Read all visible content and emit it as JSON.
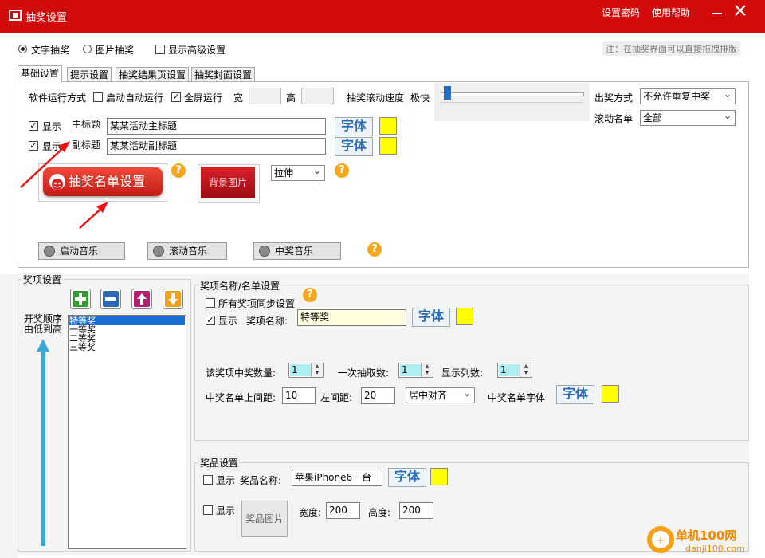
{
  "window": {
    "title": "抽奖设置",
    "links": [
      "设置密码",
      "使用帮助"
    ]
  },
  "mode": {
    "text_lottery": "文字抽奖",
    "image_lottery": "图片抽奖",
    "show_advanced": "显示高级设置"
  },
  "hint": "注：在抽奖界面可以直接拖拽排版",
  "tabs": [
    "基础设置",
    "提示设置",
    "抽奖结果页设置",
    "抽奖封面设置"
  ],
  "basic": {
    "run_mode_label": "软件运行方式",
    "auto_start": "启动自动运行",
    "fullscreen": "全屏运行",
    "width_label": "宽",
    "height_label": "高",
    "speed_label": "抽奖滚动速度",
    "speed_fast": "极快",
    "speed_value": 0.02,
    "draw_mode_label": "出奖方式",
    "draw_mode_value": "不允许重复中奖",
    "scroll_list_label": "滚动名单",
    "scroll_list_value": "全部",
    "show": "显示",
    "main_title_label": "主标题",
    "main_title_value": "某某活动主标题",
    "sub_title_label": "副标题",
    "sub_title_value": "某某活动副标题",
    "font_btn": "字体",
    "name_list_btn": "抽奖名单设置",
    "bg_image_btn": "背景图片",
    "stretch_value": "拉伸",
    "music": [
      "启动音乐",
      "滚动音乐",
      "中奖音乐"
    ],
    "colors": {
      "swatch": "#ffff00",
      "titlebar": "#d10b0b",
      "name_list_btn": "#d72c22"
    }
  },
  "prizes": {
    "group_title": "奖项设置",
    "order_label": "开奖顺序\n由低到高",
    "order_line1": "开奖顺序",
    "order_line2": "由低到高",
    "toolbar_icons": [
      "add-icon",
      "remove-icon",
      "move-up-icon",
      "move-down-icon"
    ],
    "items": [
      "特等奖",
      "一等奖",
      "二等奖",
      "三等奖"
    ],
    "selected": 0
  },
  "prize_name": {
    "group_title": "奖项名称/名单设置",
    "sync_all": "所有奖项同步设置",
    "show": "显示",
    "name_label": "奖项名称:",
    "name_value": "特等奖",
    "font_btn": "字体",
    "count_label": "该奖项中奖数量:",
    "count_value": "1",
    "per_draw_label": "一次抽取数:",
    "per_draw_value": "1",
    "columns_label": "显示列数:",
    "columns_value": "1",
    "top_margin_label": "中奖名单上间距:",
    "top_margin_value": "10",
    "left_margin_label": "左间距:",
    "left_margin_value": "20",
    "align_value": "居中对齐",
    "list_font_label": "中奖名单字体",
    "list_font_btn": "字体"
  },
  "gift": {
    "group_title": "奖品设置",
    "show": "显示",
    "name_label": "奖品名称:",
    "name_value": "苹果iPhone6一台",
    "font_btn": "字体",
    "show2": "显示",
    "image_btn": "奖品图片",
    "width_label": "宽度:",
    "width_value": "200",
    "height_label": "高度:",
    "height_value": "200"
  },
  "watermark": {
    "brand": "单机100网",
    "url": "danji100.com"
  }
}
